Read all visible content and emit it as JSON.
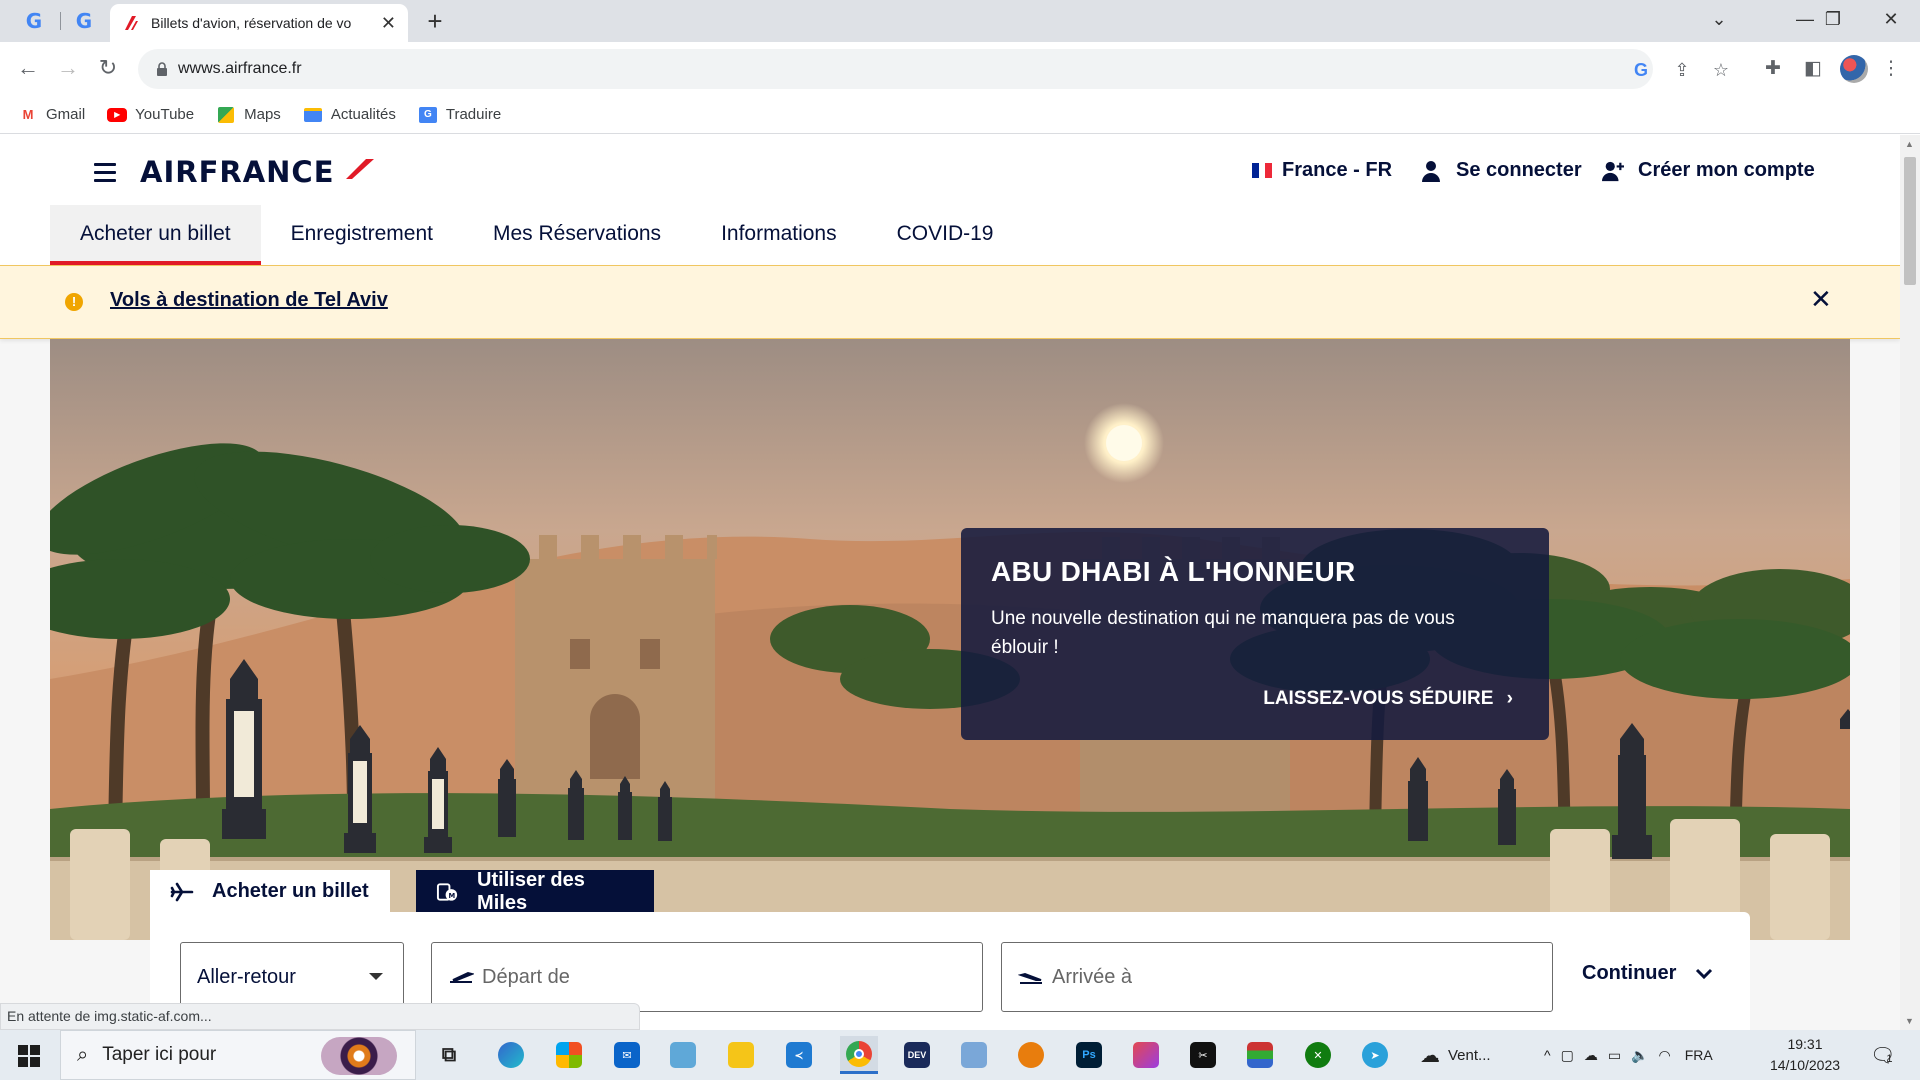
{
  "browser": {
    "tabs": [
      {
        "favicon": "google-g-icon",
        "title": "G"
      },
      {
        "favicon": "google-g-icon",
        "title": "G"
      },
      {
        "favicon": "airfrance-icon",
        "title": "Billets d'avion, réservation de vo",
        "active": true
      }
    ],
    "url": "wwws.airfrance.fr",
    "bookmarks": [
      {
        "icon": "gmail-icon",
        "label": "Gmail"
      },
      {
        "icon": "youtube-icon",
        "label": "YouTube"
      },
      {
        "icon": "maps-icon",
        "label": "Maps"
      },
      {
        "icon": "news-icon",
        "label": "Actualités"
      },
      {
        "icon": "translate-icon",
        "label": "Traduire"
      }
    ],
    "status_text": "En attente de img.static-af.com..."
  },
  "site": {
    "logo_text": "AIRFRANCE",
    "country": "France - FR",
    "login": "Se connecter",
    "create_account": "Créer mon compte",
    "nav": [
      "Acheter un billet",
      "Enregistrement",
      "Mes Réservations",
      "Informations",
      "COVID-19"
    ],
    "alert": {
      "icon": "warning-icon",
      "text": "Vols à destination de Tel Aviv"
    },
    "promo": {
      "title": "ABU DHABI À L'HONNEUR",
      "text": "Une nouvelle destination qui ne manquera pas de vous éblouir !",
      "cta": "LAISSEZ-VOUS SÉDUIRE"
    },
    "booking": {
      "tab_buy": "Acheter un billet",
      "tab_miles": "Utiliser des Miles",
      "trip_type": "Aller-retour",
      "departure_placeholder": "Départ de",
      "arrival_placeholder": "Arrivée à",
      "continue": "Continuer"
    }
  },
  "taskbar": {
    "search_placeholder": "Taper ici pour",
    "weather": "Vent...",
    "language": "FRA",
    "time": "19:31",
    "date": "14/10/2023",
    "notifications": "1"
  },
  "colors": {
    "brand_navy": "#051039",
    "brand_red": "#e11a27",
    "alert_bg": "#fff5dd"
  }
}
